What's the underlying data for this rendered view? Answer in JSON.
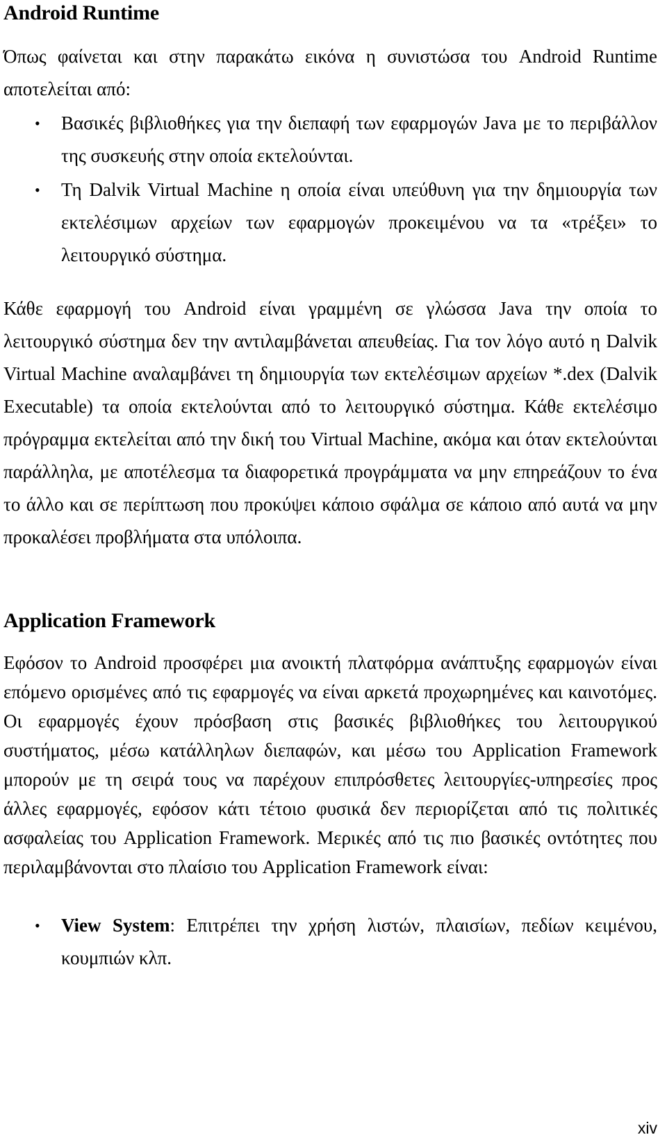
{
  "document": {
    "page_number": "xiv",
    "sections": [
      {
        "id": "android-runtime",
        "heading": "Android Runtime",
        "intro": "Όπως φαίνεται και στην παρακάτω εικόνα η συνιστώσα του Android Runtime αποτελείται από:",
        "bullets": [
          "Βασικές βιβλιοθήκες για την διεπαφή των εφαρμογών Java με το περιβάλλον της συσκευής στην οποία εκτελούνται.",
          "Τη Dalvik Virtual Machine η οποία είναι υπεύθυνη για την δημιουργία των εκτελέσιμων αρχείων των εφαρμογών προκειμένου να τα «τρέξει» το λειτουργικό σύστημα."
        ],
        "body": "Κάθε εφαρμογή του Android είναι γραμμένη σε γλώσσα Java την οποία το λειτουργικό σύστημα δεν την αντιλαμβάνεται απευθείας. Για τον λόγο αυτό η Dalvik Virtual Machine αναλαμβάνει τη δημιουργία των εκτελέσιμων αρχείων *.dex (Dalvik Executable) τα οποία εκτελούνται από το λειτουργικό σύστημα. Κάθε εκτελέσιμο πρόγραμμα εκτελείται από την δική του Virtual Machine, ακόμα και όταν εκτελούνται παράλληλα, με αποτέλεσμα τα διαφορετικά προγράμματα να μην επηρεάζουν το ένα το άλλο και σε περίπτωση που προκύψει κάποιο σφάλμα σε κάποιο από αυτά να μην προκαλέσει προβλήματα στα υπόλοιπα."
      },
      {
        "id": "application-framework",
        "heading": "Application Framework",
        "body": "Εφόσον το Android προσφέρει μια ανοικτή πλατφόρμα ανάπτυξης εφαρμογών είναι επόμενο ορισμένες από τις εφαρμογές να είναι αρκετά προχωρημένες και καινοτόμες. Οι εφαρμογές έχουν πρόσβαση στις βασικές βιβλιοθήκες του λειτουργικού συστήματος, μέσω κατάλληλων διεπαφών, και μέσω του Application Framework μπορούν με τη σειρά τους να παρέχουν επιπρόσθετες λειτουργίες-υπηρεσίες προς άλλες εφαρμογές, εφόσον κάτι τέτοιο φυσικά δεν περιορίζεται από τις πολιτικές ασφαλείας του Application Framework. Μερικές από τις πιο βασικές οντότητες που περιλαμβάνονται στο πλαίσιο του Application Framework είναι:",
        "bullets": [
          {
            "term": "View System",
            "separator": ": ",
            "description": "Επιτρέπει την χρήση λιστών, πλαισίων, πεδίων κειμένου, κουμπιών κλπ."
          }
        ]
      }
    ]
  }
}
